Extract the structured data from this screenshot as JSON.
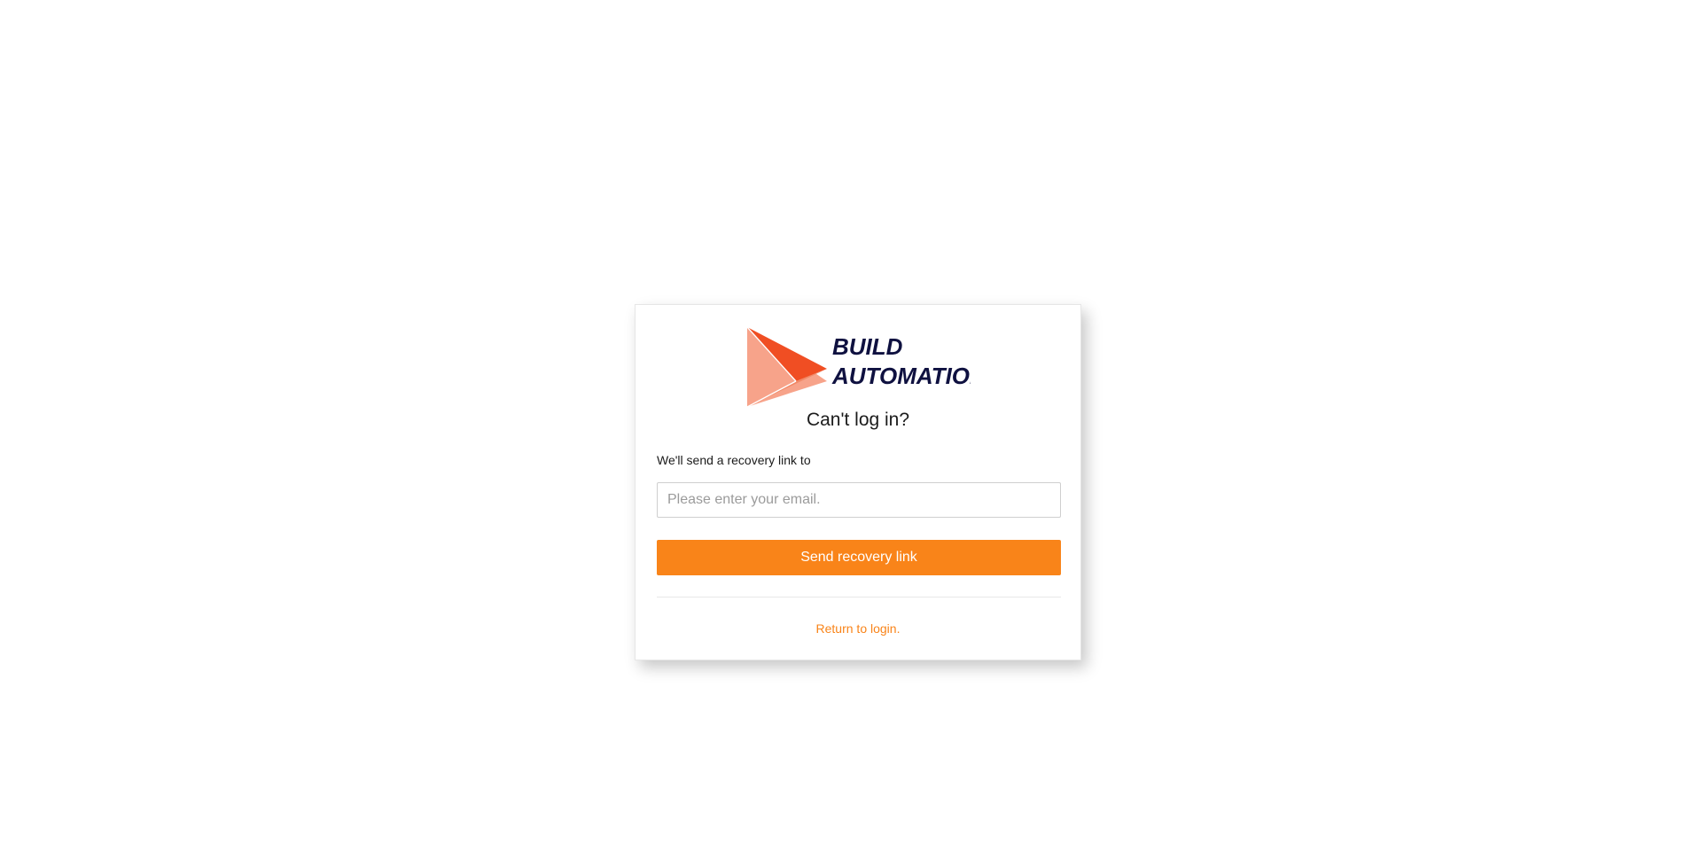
{
  "logo": {
    "line1": "BUILD",
    "line2": "AUTOMATION",
    "text_color": "#0f1140",
    "mark_colors": [
      "#f04e23",
      "#f7a38a",
      "#f18866"
    ]
  },
  "recovery": {
    "title": "Can't log in?",
    "label": "We'll send a recovery link to",
    "email_placeholder": "Please enter your email.",
    "email_value": "",
    "send_button_label": "Send recovery link",
    "return_link_label": "Return to login."
  },
  "colors": {
    "accent": "#f98419",
    "background": "#ffffff"
  }
}
